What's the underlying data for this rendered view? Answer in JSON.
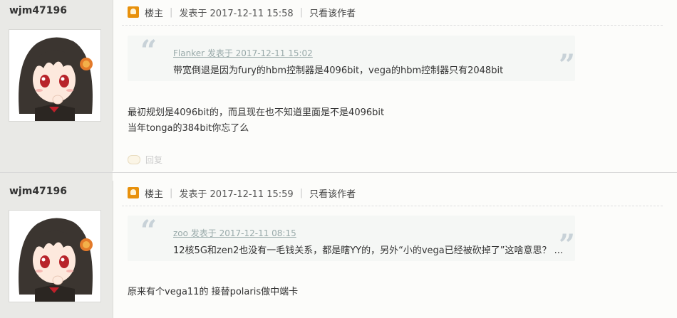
{
  "posts": [
    {
      "author": "wjm47196",
      "louzhu": "楼主",
      "posted": "发表于 2017-12-11 15:58",
      "only_author": "只看该作者",
      "quote": {
        "header": "Flanker 发表于 2017-12-11 15:02",
        "text": "带宽倒退是因为fury的hbm控制器是4096bit，vega的hbm控制器只有2048bit"
      },
      "body": [
        "最初规划是4096bit的，而且现在也不知道里面是不是4096bit",
        "当年tonga的384bit你忘了么"
      ],
      "reply_label": "回复"
    },
    {
      "author": "wjm47196",
      "louzhu": "楼主",
      "posted": "发表于 2017-12-11 15:59",
      "only_author": "只看该作者",
      "quote": {
        "header": "zoo 发表于 2017-12-11 08:15",
        "text": "12核5G和zen2也没有一毛钱关系，都是瞎YY的，另外“小的vega已经被砍掉了”这啥意思？ ..."
      },
      "body": [
        "原来有个vega11的 接替polaris做中端卡"
      ]
    }
  ],
  "colors": {
    "badge": "#e8910c",
    "sidebar": "#e9e9e6",
    "quote_bg": "#f5f7f5",
    "quote_mark": "#c8d2d8",
    "page_bg": "#fcfcfa"
  },
  "icons": {
    "louzhu_badge": "user-badge-icon",
    "open_quote": "open-quote-icon",
    "close_quote": "close-quote-icon",
    "reply": "reply-icon"
  }
}
